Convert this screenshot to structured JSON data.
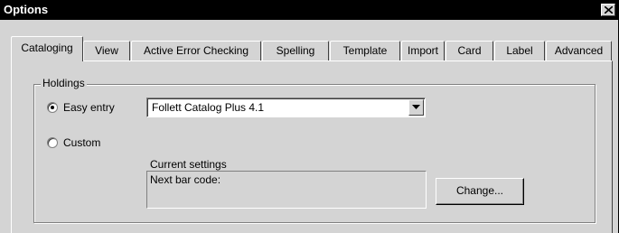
{
  "window": {
    "title": "Options"
  },
  "tabs": [
    {
      "label": "Cataloging",
      "active": true
    },
    {
      "label": "View"
    },
    {
      "label": "Active Error Checking"
    },
    {
      "label": "Spelling"
    },
    {
      "label": "Template"
    },
    {
      "label": "Import"
    },
    {
      "label": "Card"
    },
    {
      "label": "Label"
    },
    {
      "label": "Advanced"
    }
  ],
  "holdings": {
    "group_label": "Holdings",
    "easy_entry_label": "Easy entry",
    "custom_label": "Custom",
    "selected_option": "Easy entry",
    "dropdown_value": "Follett Catalog Plus 4.1",
    "current_settings_label": "Current settings",
    "current_settings_value": "Next bar code:",
    "change_button_label": "Change..."
  },
  "icons": {
    "close": "close-icon",
    "dropdown": "chevron-down-icon"
  }
}
